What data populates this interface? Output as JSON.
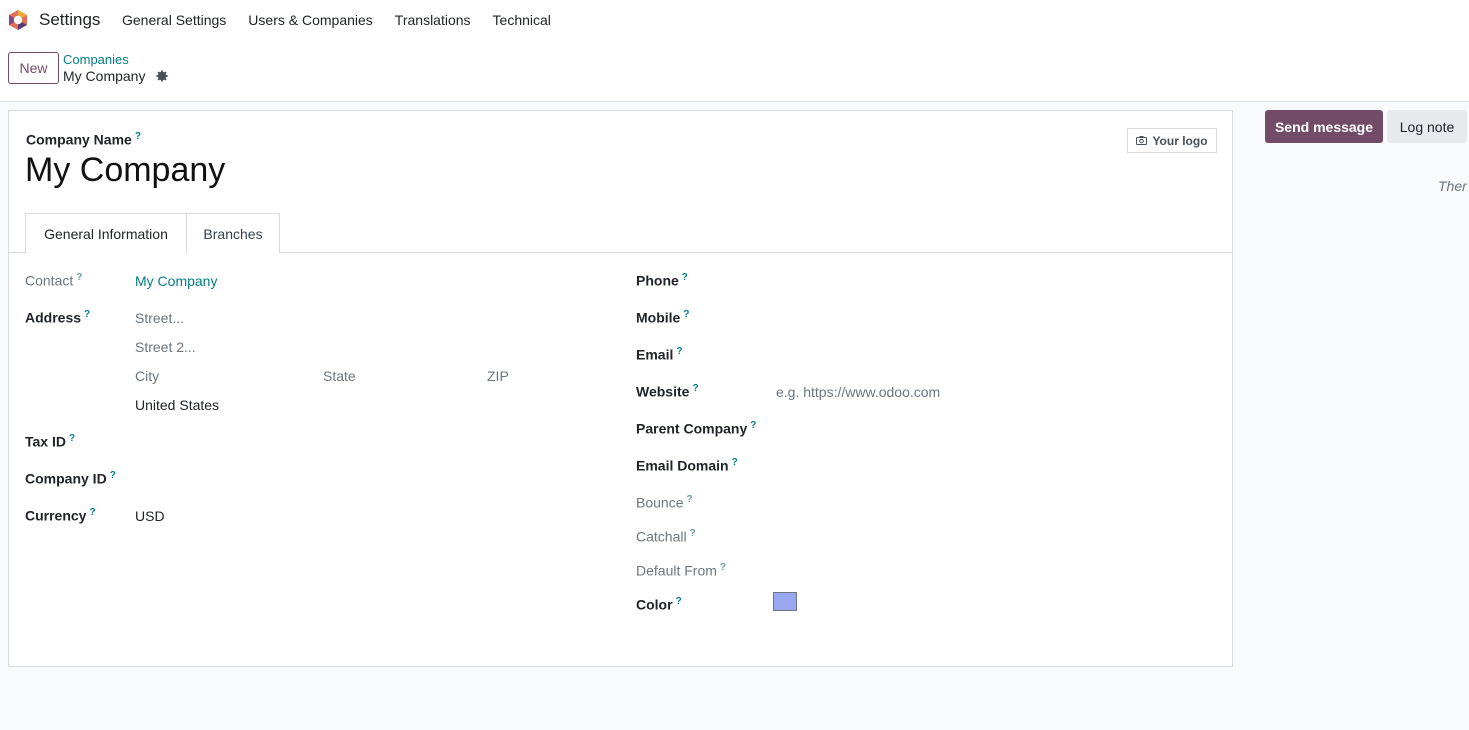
{
  "topbar": {
    "app_title": "Settings",
    "menu": [
      "General Settings",
      "Users & Companies",
      "Translations",
      "Technical"
    ]
  },
  "control": {
    "new_label": "New",
    "breadcrumb_parent": "Companies",
    "breadcrumb_current": "My Company"
  },
  "form": {
    "company_name_label": "Company Name",
    "company_name_value": "My Company",
    "logo_button": "Your logo",
    "tabs": [
      "General Information",
      "Branches"
    ],
    "left": {
      "contact_label": "Contact",
      "contact_value": "My Company",
      "address_label": "Address",
      "street_placeholder": "Street...",
      "street2_placeholder": "Street 2...",
      "city_placeholder": "City",
      "state_placeholder": "State",
      "zip_placeholder": "ZIP",
      "country_value": "United States",
      "tax_id_label": "Tax ID",
      "company_id_label": "Company ID",
      "currency_label": "Currency",
      "currency_value": "USD"
    },
    "right": {
      "phone_label": "Phone",
      "mobile_label": "Mobile",
      "email_label": "Email",
      "website_label": "Website",
      "website_placeholder": "e.g. https://www.odoo.com",
      "parent_company_label": "Parent Company",
      "email_domain_label": "Email Domain",
      "bounce_label": "Bounce",
      "catchall_label": "Catchall",
      "default_from_label": "Default From",
      "color_label": "Color",
      "color_value": "#99a6f0"
    },
    "help_mark": "?"
  },
  "chatter": {
    "send_message": "Send message",
    "log_note": "Log note",
    "empty_text": "Ther"
  },
  "colors": {
    "brand": "#714b67",
    "link": "#017e84"
  }
}
